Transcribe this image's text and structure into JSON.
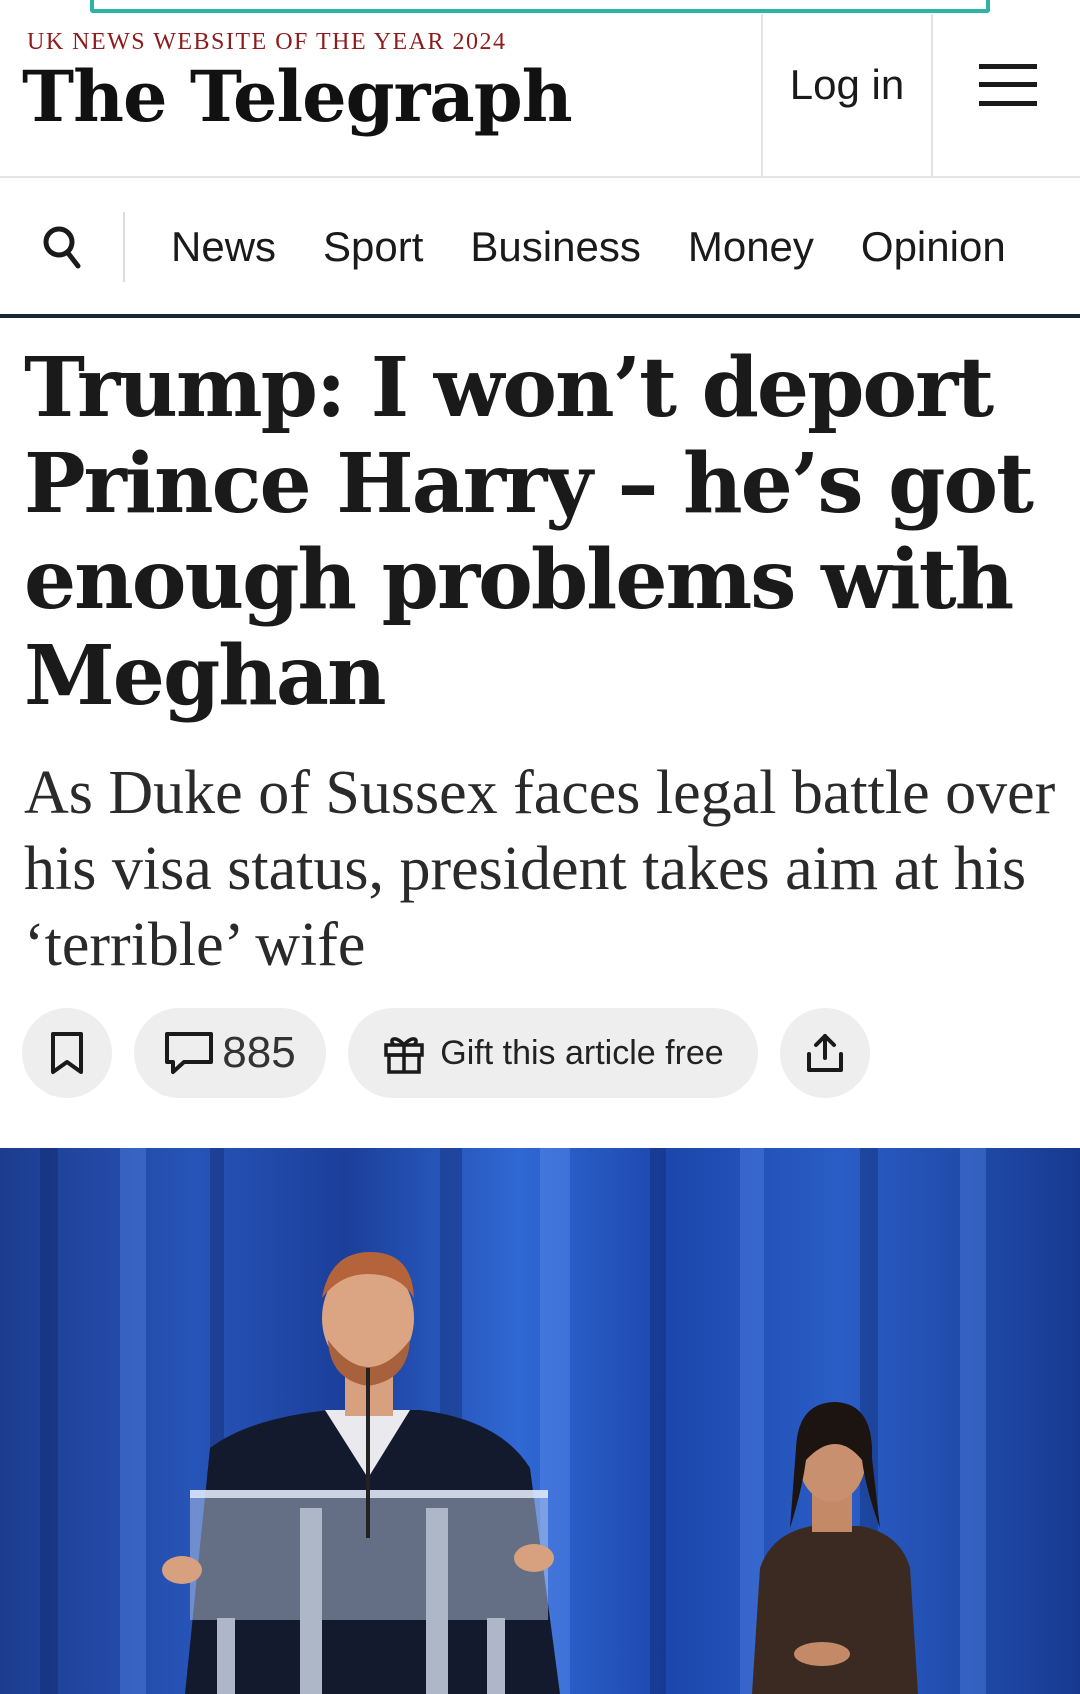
{
  "masthead": {
    "award": "UK NEWS WEBSITE OF THE YEAR 2024",
    "logo": "The Telegraph",
    "login_label": "Log in",
    "menu_icon": "hamburger-menu-icon"
  },
  "nav": {
    "search_icon": "search-icon",
    "items": [
      "News",
      "Sport",
      "Business",
      "Money",
      "Opinion"
    ]
  },
  "article": {
    "headline": "Trump: I won’t deport Prince Harry – he’s got enough problems with Meghan",
    "standfirst": "As Duke of Sussex faces legal battle over his visa status, president takes aim at his ‘terrible’ wife",
    "comment_count": "885",
    "gift_label": "Gift this article free"
  },
  "colors": {
    "award": "#8e1b1b",
    "nav_rule": "#1a2630",
    "pill_bg": "#eeeeee",
    "ad_border": "#2bb3a8"
  }
}
